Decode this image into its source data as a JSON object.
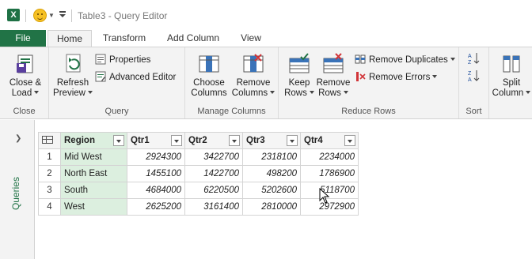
{
  "window": {
    "title": "Table3 - Query Editor"
  },
  "tabs": {
    "file": "File",
    "home": "Home",
    "transform": "Transform",
    "add_column": "Add Column",
    "view": "View"
  },
  "ribbon": {
    "close_group": {
      "label": "Close",
      "close_load_line1": "Close &",
      "close_load_line2": "Load"
    },
    "query_group": {
      "label": "Query",
      "refresh_line1": "Refresh",
      "refresh_line2": "Preview",
      "properties": "Properties",
      "advanced_editor": "Advanced Editor"
    },
    "manage_columns_group": {
      "label": "Manage Columns",
      "choose_line1": "Choose",
      "choose_line2": "Columns",
      "remove_line1": "Remove",
      "remove_line2": "Columns"
    },
    "reduce_rows_group": {
      "label": "Reduce Rows",
      "keep_line1": "Keep",
      "keep_line2": "Rows",
      "remove_line1": "Remove",
      "remove_line2": "Rows",
      "remove_duplicates": "Remove Duplicates",
      "remove_errors": "Remove Errors"
    },
    "sort_group": {
      "label": "Sort"
    },
    "split_group": {
      "split_line1": "Split",
      "split_line2": "Column"
    }
  },
  "queries_pane": {
    "label": "Queries"
  },
  "table": {
    "headers": [
      "Region",
      "Qtr1",
      "Qtr2",
      "Qtr3",
      "Qtr4"
    ],
    "rows": [
      {
        "idx": "1",
        "region": "Mid West",
        "q1": "2924300",
        "q2": "3422700",
        "q3": "2318100",
        "q4": "2234000"
      },
      {
        "idx": "2",
        "region": "North East",
        "q1": "1455100",
        "q2": "1422700",
        "q3": "498200",
        "q4": "1786900"
      },
      {
        "idx": "3",
        "region": "South",
        "q1": "4684000",
        "q2": "6220500",
        "q3": "5202600",
        "q4": "5118700"
      },
      {
        "idx": "4",
        "region": "West",
        "q1": "2625200",
        "q2": "3161400",
        "q3": "2810000",
        "q4": "2972900"
      }
    ]
  },
  "colors": {
    "accent": "#217346",
    "region_highlight": "#dcefdf"
  }
}
